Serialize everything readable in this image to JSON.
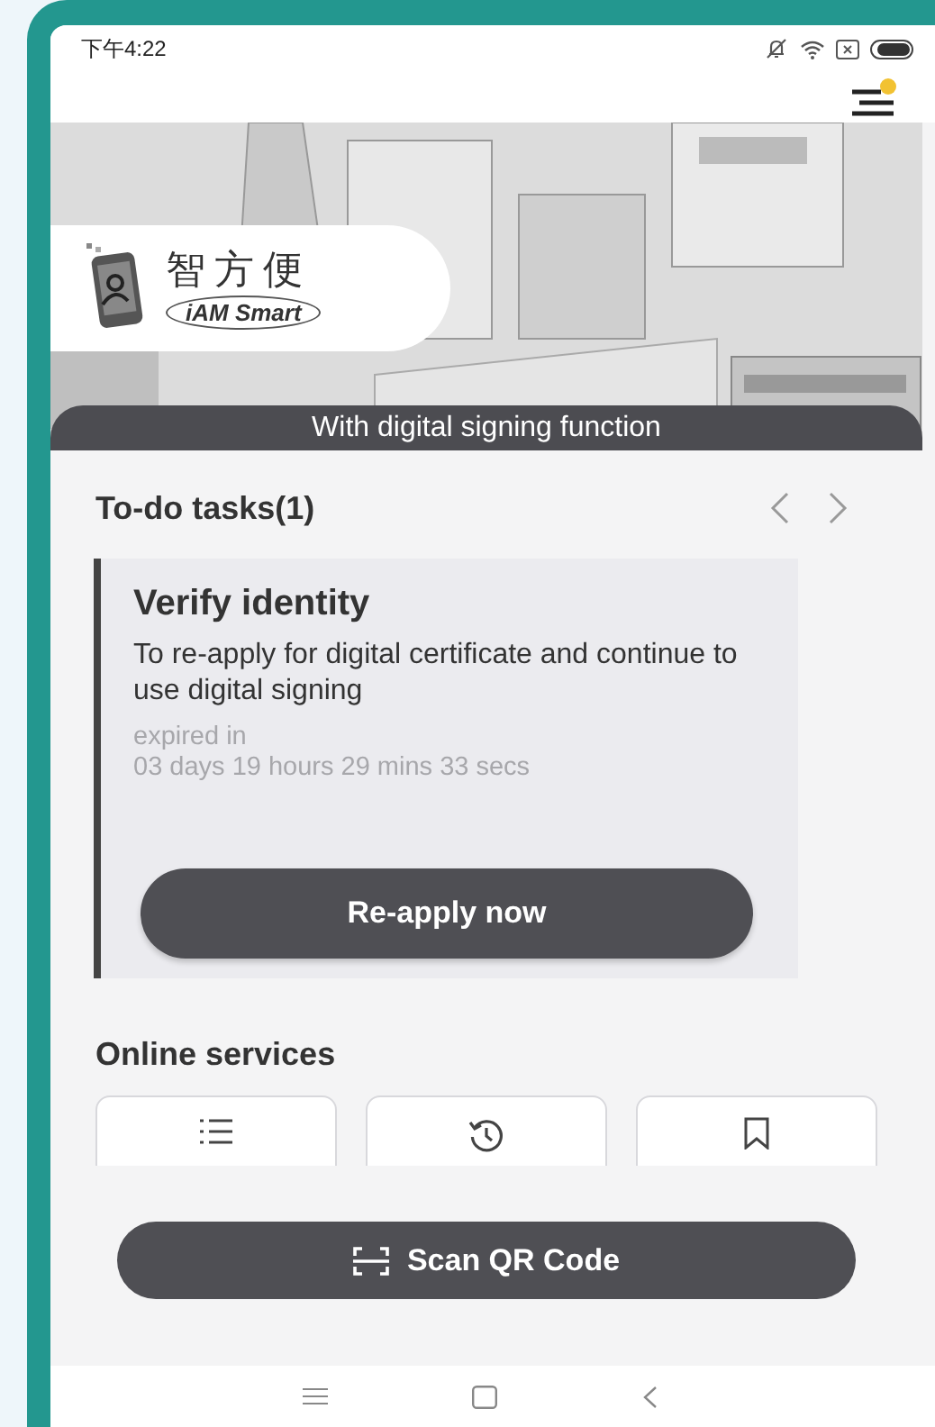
{
  "status_bar": {
    "time": "下午4:22"
  },
  "banner": {
    "logo_chinese": "智方便",
    "logo_english": "iAM Smart",
    "caption": "With digital signing function"
  },
  "todo": {
    "title": "To-do tasks(1)",
    "tasks": [
      {
        "title": "Verify identity",
        "description": "To re-apply for digital certificate and continue to use digital signing",
        "expiry_label": "expired in",
        "countdown": "03 days 19 hours 29 mins 33 secs",
        "action": "Re-apply now"
      }
    ]
  },
  "online_services": {
    "title": "Online services",
    "tiles": [
      {
        "kind": "list"
      },
      {
        "kind": "history"
      },
      {
        "kind": "bookmark"
      }
    ]
  },
  "scan_button": {
    "label": "Scan QR Code"
  }
}
